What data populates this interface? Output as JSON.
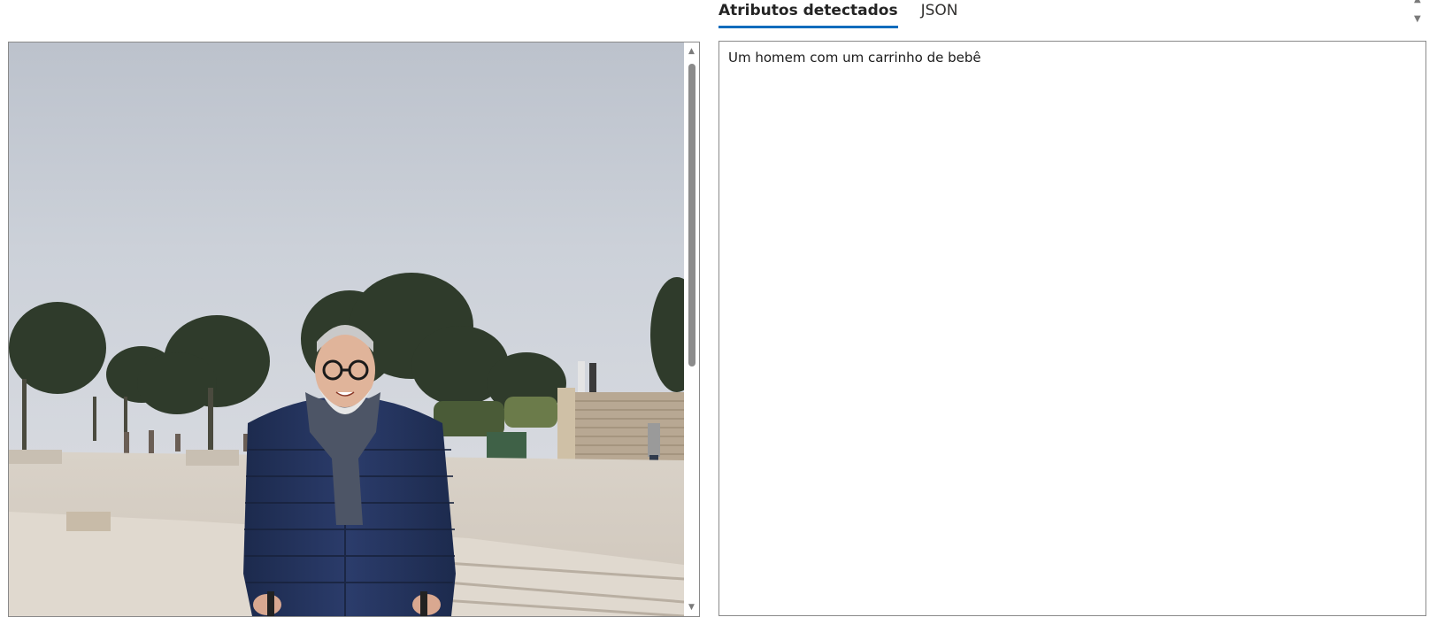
{
  "tabs": [
    {
      "label": "Atributos detectados",
      "active": true
    },
    {
      "label": "JSON",
      "active": false
    }
  ],
  "result": {
    "caption": "Um homem com um carrinho de bebê"
  },
  "image_viewer": {
    "scroll_up_icon": "triangle-up-icon",
    "scroll_down_icon": "triangle-down-icon"
  },
  "colors": {
    "tab_underline": "#0f6cbd",
    "border": "#8a8a8a",
    "scroll_thumb": "#8b8b8b"
  }
}
